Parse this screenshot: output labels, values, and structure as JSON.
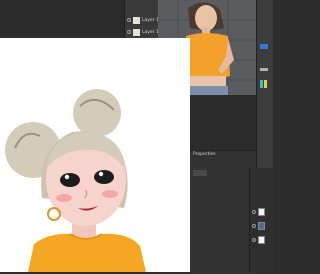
{
  "colors": {
    "app_bg": "#2c2c2c",
    "canvas_bg": "#ffffff",
    "shirt": "#f5a623",
    "hair": "#d4cbb8",
    "photo_shirt": "#f2a12a"
  },
  "layers_panel": {
    "items": [
      {
        "label": "Layer 1"
      },
      {
        "label": "Layer 1"
      }
    ]
  },
  "properties_panel": {
    "title": "Properties"
  }
}
